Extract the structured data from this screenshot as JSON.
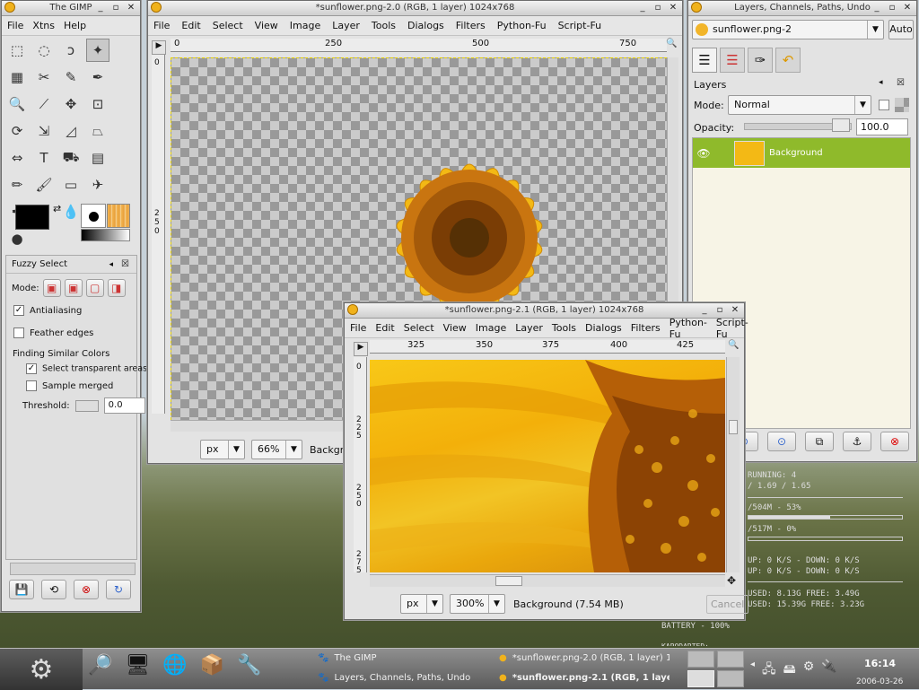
{
  "toolbox": {
    "title": "The GIMP",
    "menu": [
      "File",
      "Xtns",
      "Help"
    ],
    "tools": [
      "rect-select-icon",
      "ellipse-select-icon",
      "lasso-icon",
      "fuzzy-select-icon",
      "color-select-icon",
      "scissors-icon",
      "paths-icon",
      "color-picker-icon",
      "zoom-icon",
      "measure-icon",
      "move-icon",
      "crop-icon",
      "rotate-icon",
      "scale-icon",
      "shear-icon",
      "perspective-icon",
      "flip-icon",
      "text-icon",
      "bucket-fill-icon",
      "blend-icon",
      "pencil-icon",
      "paintbrush-icon",
      "eraser-icon",
      "airbrush-icon",
      "ink-icon",
      "clone-icon",
      "blur-icon",
      "smudge-icon",
      "dodge-icon"
    ],
    "tool_glyphs": [
      "⬚",
      "◌",
      "ↄ",
      "✦",
      "▦",
      "✂",
      "✎",
      "✒",
      "🔍",
      "⟋",
      "✥",
      "⊡",
      "⟳",
      "⇲",
      "◿",
      "⏢",
      "⇔",
      "T",
      "⛟",
      "▤",
      "✏",
      "🖌",
      "▭",
      "✈",
      "✒",
      "♠",
      "💧",
      "☝",
      "●"
    ],
    "options": {
      "title": "Fuzzy Select",
      "mode_label": "Mode:",
      "antialiasing": "Antialiasing",
      "feather": "Feather edges",
      "finding": "Finding Similar Colors",
      "select_transparent": "Select transparent areas",
      "sample_merged": "Sample merged",
      "threshold_label": "Threshold:",
      "threshold": "0.0"
    }
  },
  "win1": {
    "title": "*sunflower.png-2.0 (RGB, 1 layer) 1024x768",
    "menu": [
      "File",
      "Edit",
      "Select",
      "View",
      "Image",
      "Layer",
      "Tools",
      "Dialogs",
      "Filters",
      "Python-Fu",
      "Script-Fu"
    ],
    "ruler_ticks": [
      "0",
      "250",
      "500",
      "750"
    ],
    "vruler": [
      "0",
      "2\n5\n0"
    ],
    "unit": "px",
    "zoom": "66%",
    "status": "Backgro"
  },
  "win2": {
    "title": "*sunflower.png-2.1 (RGB, 1 layer) 1024x768",
    "menu": [
      "File",
      "Edit",
      "Select",
      "View",
      "Image",
      "Layer",
      "Tools",
      "Dialogs",
      "Filters",
      "Python-Fu",
      "Script-Fu"
    ],
    "ruler_ticks": [
      "325",
      "350",
      "375",
      "400",
      "425"
    ],
    "vruler": [
      "0",
      "2\n2\n5",
      "2\n5\n0",
      "2\n7\n5"
    ],
    "unit": "px",
    "zoom": "300%",
    "status": "Background (7.54 MB)",
    "cancel": "Cancel"
  },
  "layers": {
    "title": "Layers, Channels, Paths, Undo",
    "image": "sunflower.png-2",
    "auto": "Auto",
    "panel": "Layers",
    "mode_label": "Mode:",
    "mode": "Normal",
    "opacity_label": "Opacity:",
    "opacity": "100.0",
    "layer_name": "Background"
  },
  "monitor": [
    "RUNNING: 4",
    "/ 1.69 / 1.65",
    "/504M - 53%",
    "/517M - 0%",
    "UP: 0 K/S - DOWN: 0 K/S",
    "UP: 0 K/S - DOWN: 0 K/S",
    "USED: 8.13G  FREE: 3.49G",
    "USED: 15.39G  FREE: 3.23G",
    "BATTERY - 100%",
    "KAPODARTED:"
  ],
  "taskbar": {
    "tasks": [
      "The GIMP",
      "Layers, Channels, Paths, Undo",
      "*sunflower.png-2.0 (RGB, 1 layer) 102",
      "*sunflower.png-2.1 (RGB, 1 layer)"
    ],
    "clock": "16:14",
    "date": "2006-03-26"
  }
}
